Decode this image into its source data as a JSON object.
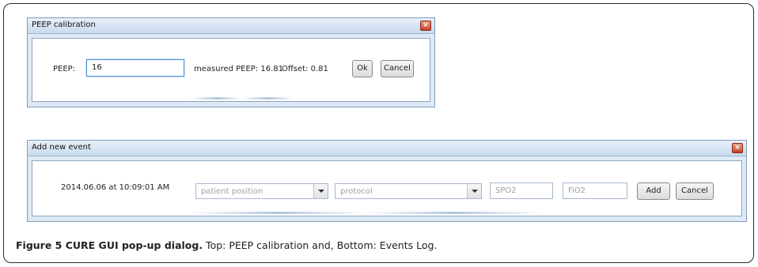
{
  "peep_dialog": {
    "title": "PEEP calibration",
    "close_glyph": "×",
    "peep_label": "PEEP:",
    "peep_value": "16",
    "measured_text": "measured PEEP: 16.81",
    "offset_text": "Offset: 0.81",
    "ok_label": "Ok",
    "cancel_label": "Cancel"
  },
  "event_dialog": {
    "title": "Add new event",
    "close_glyph": "×",
    "timestamp": "2014.06.06 at 10:09:01 AM",
    "position_placeholder": "patient position",
    "protocol_placeholder": "protocol",
    "spo2_placeholder": "SPO2",
    "fio2_placeholder": "FiO2",
    "add_label": "Add",
    "cancel_label": "Cancel"
  },
  "caption": {
    "bold": "Figure 5 CURE GUI pop-up dialog.",
    "text": " Top: PEEP calibration and, Bottom: Events Log."
  },
  "icons": [
    "close-icon",
    "dropdown-arrow-icon"
  ],
  "colors": {
    "titlebar": "#c9daee",
    "dialog_bg": "#dfe9f5",
    "close_button": "#c4412a",
    "focus_border": "#4a90d9"
  }
}
